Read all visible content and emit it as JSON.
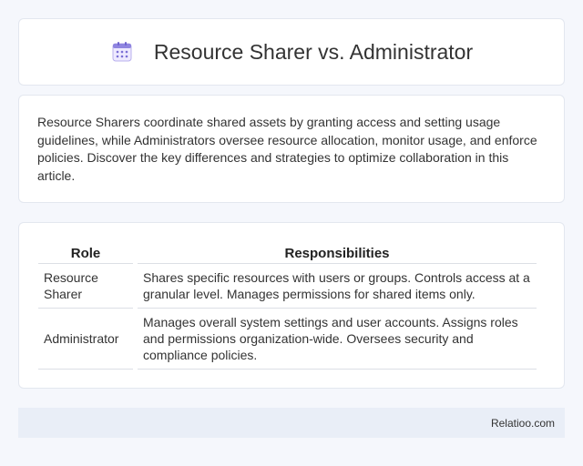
{
  "header": {
    "title": "Resource Sharer vs. Administrator",
    "icon": "calendar-icon"
  },
  "intro": {
    "text": "Resource Sharers coordinate shared assets by granting access and setting usage guidelines, while Administrators oversee resource allocation, monitor usage, and enforce policies. Discover the key differences and strategies to optimize collaboration in this article."
  },
  "table": {
    "headers": [
      "Role",
      "Responsibilities"
    ],
    "rows": [
      {
        "role": "Resource Sharer",
        "responsibilities": "Shares specific resources with users or groups. Controls access at a granular level. Manages permissions for shared items only."
      },
      {
        "role": "Administrator",
        "responsibilities": "Manages overall system settings and user accounts. Assigns roles and permissions organization-wide. Oversees security and compliance policies."
      }
    ]
  },
  "footer": {
    "brand": "Relatioo.com"
  },
  "colors": {
    "background": "#f5f7fc",
    "card": "#ffffff",
    "footer": "#e9eef7",
    "icon_accent": "#7b6fd6"
  }
}
